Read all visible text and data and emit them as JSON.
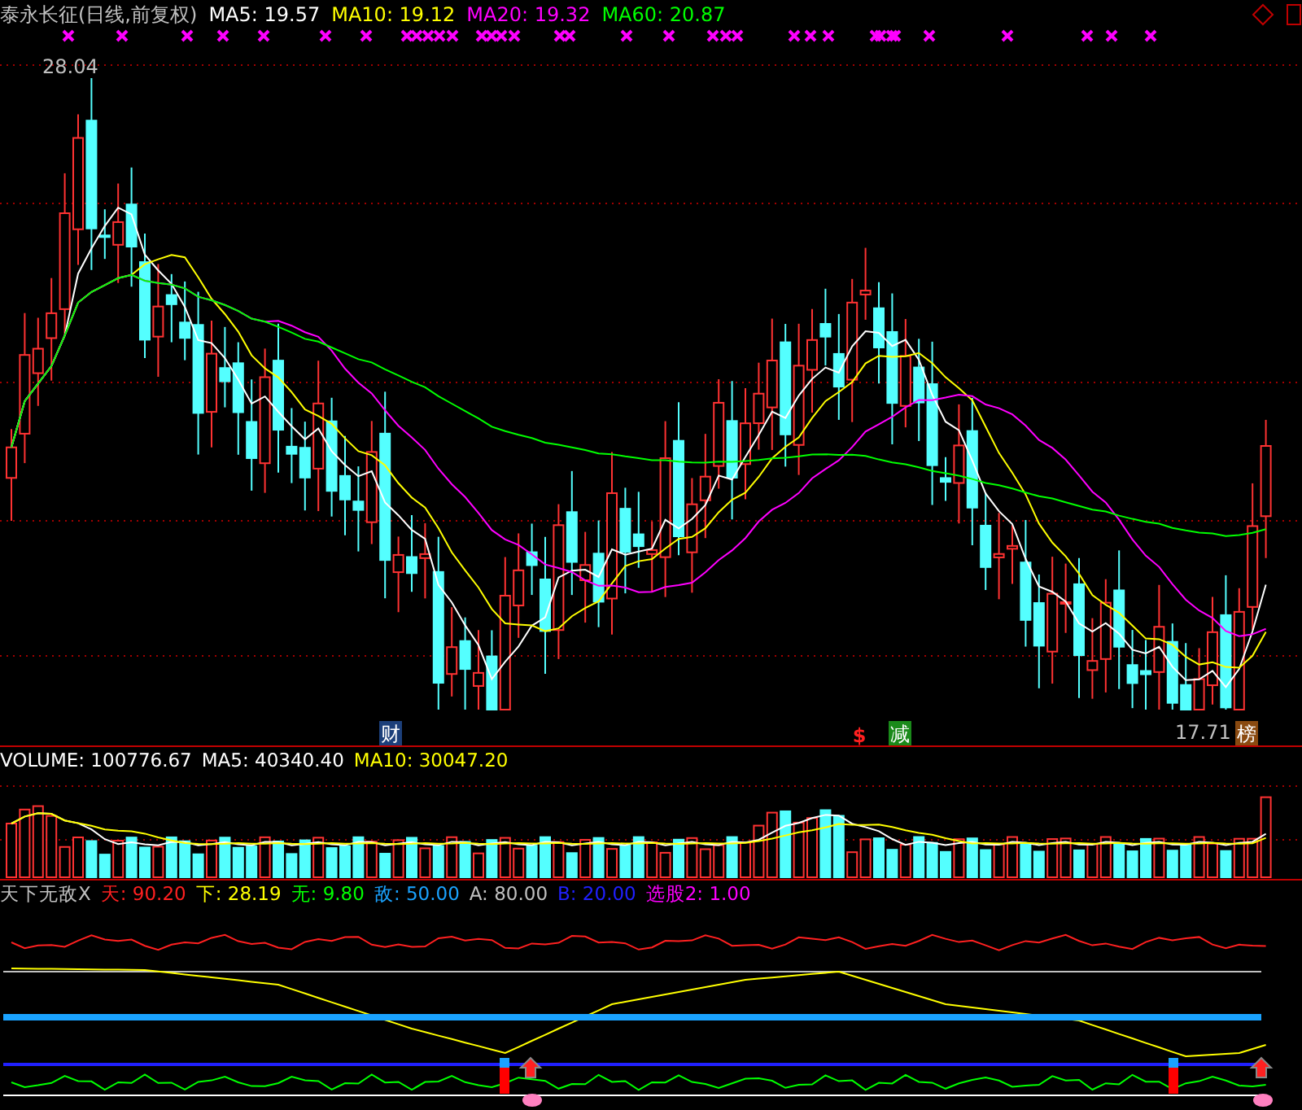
{
  "header": {
    "title": "泰永长征(日线,前复权)",
    "indicators": [
      {
        "text": "MA5: 19.57",
        "color": "#ffffff"
      },
      {
        "text": "MA10: 19.12",
        "color": "#ffff00"
      },
      {
        "text": "MA20: 19.32",
        "color": "#ff00ff"
      },
      {
        "text": "MA60: 20.87",
        "color": "#00ff00"
      }
    ]
  },
  "price_chart": {
    "high_label": "28.04",
    "low_label": "17.71",
    "event_tags": [
      {
        "kind": "badge",
        "text": "财",
        "color": "#1c3f7a"
      },
      {
        "kind": "mark",
        "text": "$",
        "color": "#ff2020"
      },
      {
        "kind": "badge",
        "text": "减",
        "color": "#1a8a1a"
      },
      {
        "kind": "badge",
        "text": "榜",
        "color": "#8a4a10"
      }
    ]
  },
  "volume_panel": {
    "indicators": [
      {
        "text": "VOLUME: 100776.67",
        "color": "#ffffff"
      },
      {
        "text": "MA5: 40340.40",
        "color": "#ffffff"
      },
      {
        "text": "MA10: 30047.20",
        "color": "#ffff00"
      }
    ]
  },
  "indicator_panel": {
    "name": "天下无敌X",
    "indicators": [
      {
        "text": "天: 90.20",
        "color": "#ff2020"
      },
      {
        "text": "下: 28.19",
        "color": "#ffff00"
      },
      {
        "text": "无: 9.80",
        "color": "#00ff00"
      },
      {
        "text": "敌: 50.00",
        "color": "#1aa3ff"
      },
      {
        "text": "A: 80.00",
        "color": "#c0c0c0"
      },
      {
        "text": "B: 20.00",
        "color": "#2020ff"
      },
      {
        "text": "选股2: 1.00",
        "color": "#ff00ff"
      }
    ]
  }
}
